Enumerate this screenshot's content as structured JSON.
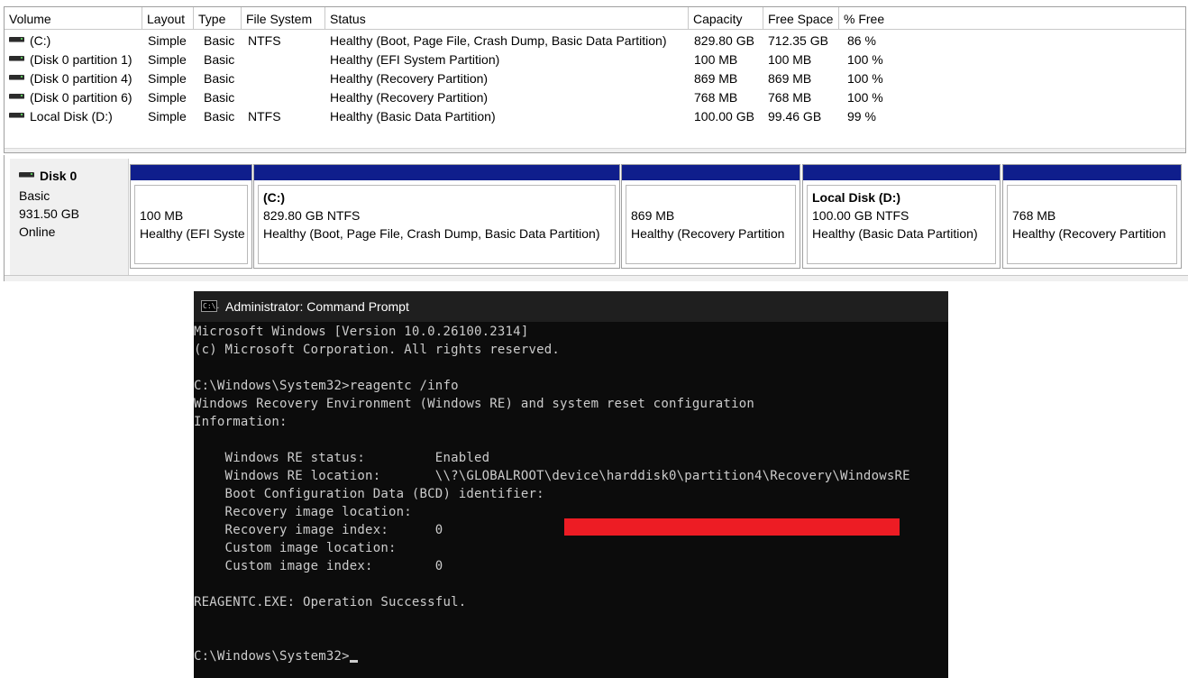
{
  "volume_list": {
    "columns": [
      "Volume",
      "Layout",
      "Type",
      "File System",
      "Status",
      "Capacity",
      "Free Space",
      "% Free"
    ],
    "rows": [
      {
        "volume": "(C:)",
        "layout": "Simple",
        "type": "Basic",
        "fs": "NTFS",
        "status": "Healthy (Boot, Page File, Crash Dump, Basic Data Partition)",
        "capacity": "829.80 GB",
        "free": "712.35 GB",
        "pct": "86 %"
      },
      {
        "volume": "(Disk 0 partition 1)",
        "layout": "Simple",
        "type": "Basic",
        "fs": "",
        "status": "Healthy (EFI System Partition)",
        "capacity": "100 MB",
        "free": "100 MB",
        "pct": "100 %"
      },
      {
        "volume": "(Disk 0 partition 4)",
        "layout": "Simple",
        "type": "Basic",
        "fs": "",
        "status": "Healthy (Recovery Partition)",
        "capacity": "869 MB",
        "free": "869 MB",
        "pct": "100 %"
      },
      {
        "volume": "(Disk 0 partition 6)",
        "layout": "Simple",
        "type": "Basic",
        "fs": "",
        "status": "Healthy (Recovery Partition)",
        "capacity": "768 MB",
        "free": "768 MB",
        "pct": "100 %"
      },
      {
        "volume": "Local Disk (D:)",
        "layout": "Simple",
        "type": "Basic",
        "fs": "NTFS",
        "status": "Healthy (Basic Data Partition)",
        "capacity": "100.00 GB",
        "free": "99.46 GB",
        "pct": "99 %"
      }
    ]
  },
  "disk": {
    "name": "Disk 0",
    "type": "Basic",
    "size": "931.50 GB",
    "state": "Online",
    "partitions": [
      {
        "title": "",
        "line1": "100 MB",
        "line2": "Healthy (EFI Syste"
      },
      {
        "title": "(C:)",
        "line1": "829.80 GB NTFS",
        "line2": "Healthy (Boot, Page File, Crash Dump, Basic Data Partition)"
      },
      {
        "title": "",
        "line1": "869 MB",
        "line2": "Healthy (Recovery Partition"
      },
      {
        "title": "Local Disk  (D:)",
        "line1": "100.00 GB NTFS",
        "line2": "Healthy (Basic Data Partition)"
      },
      {
        "title": "",
        "line1": "768 MB",
        "line2": "Healthy (Recovery Partition"
      }
    ]
  },
  "cmd": {
    "title": "Administrator: Command Prompt",
    "icon_text": "C:\\.",
    "lines": [
      "Microsoft Windows [Version 10.0.26100.2314]",
      "(c) Microsoft Corporation. All rights reserved.",
      "",
      "C:\\Windows\\System32>reagentc /info",
      "Windows Recovery Environment (Windows RE) and system reset configuration",
      "Information:",
      "",
      "    Windows RE status:         Enabled",
      "    Windows RE location:       \\\\?\\GLOBALROOT\\device\\harddisk0\\partition4\\Recovery\\WindowsRE",
      "    Boot Configuration Data (BCD) identifier: ",
      "    Recovery image location:",
      "    Recovery image index:      0",
      "    Custom image location:",
      "    Custom image index:        0",
      "",
      "REAGENTC.EXE: Operation Successful.",
      "",
      "",
      "C:\\Windows\\System32>"
    ],
    "redaction_color": "#ed1c24"
  }
}
